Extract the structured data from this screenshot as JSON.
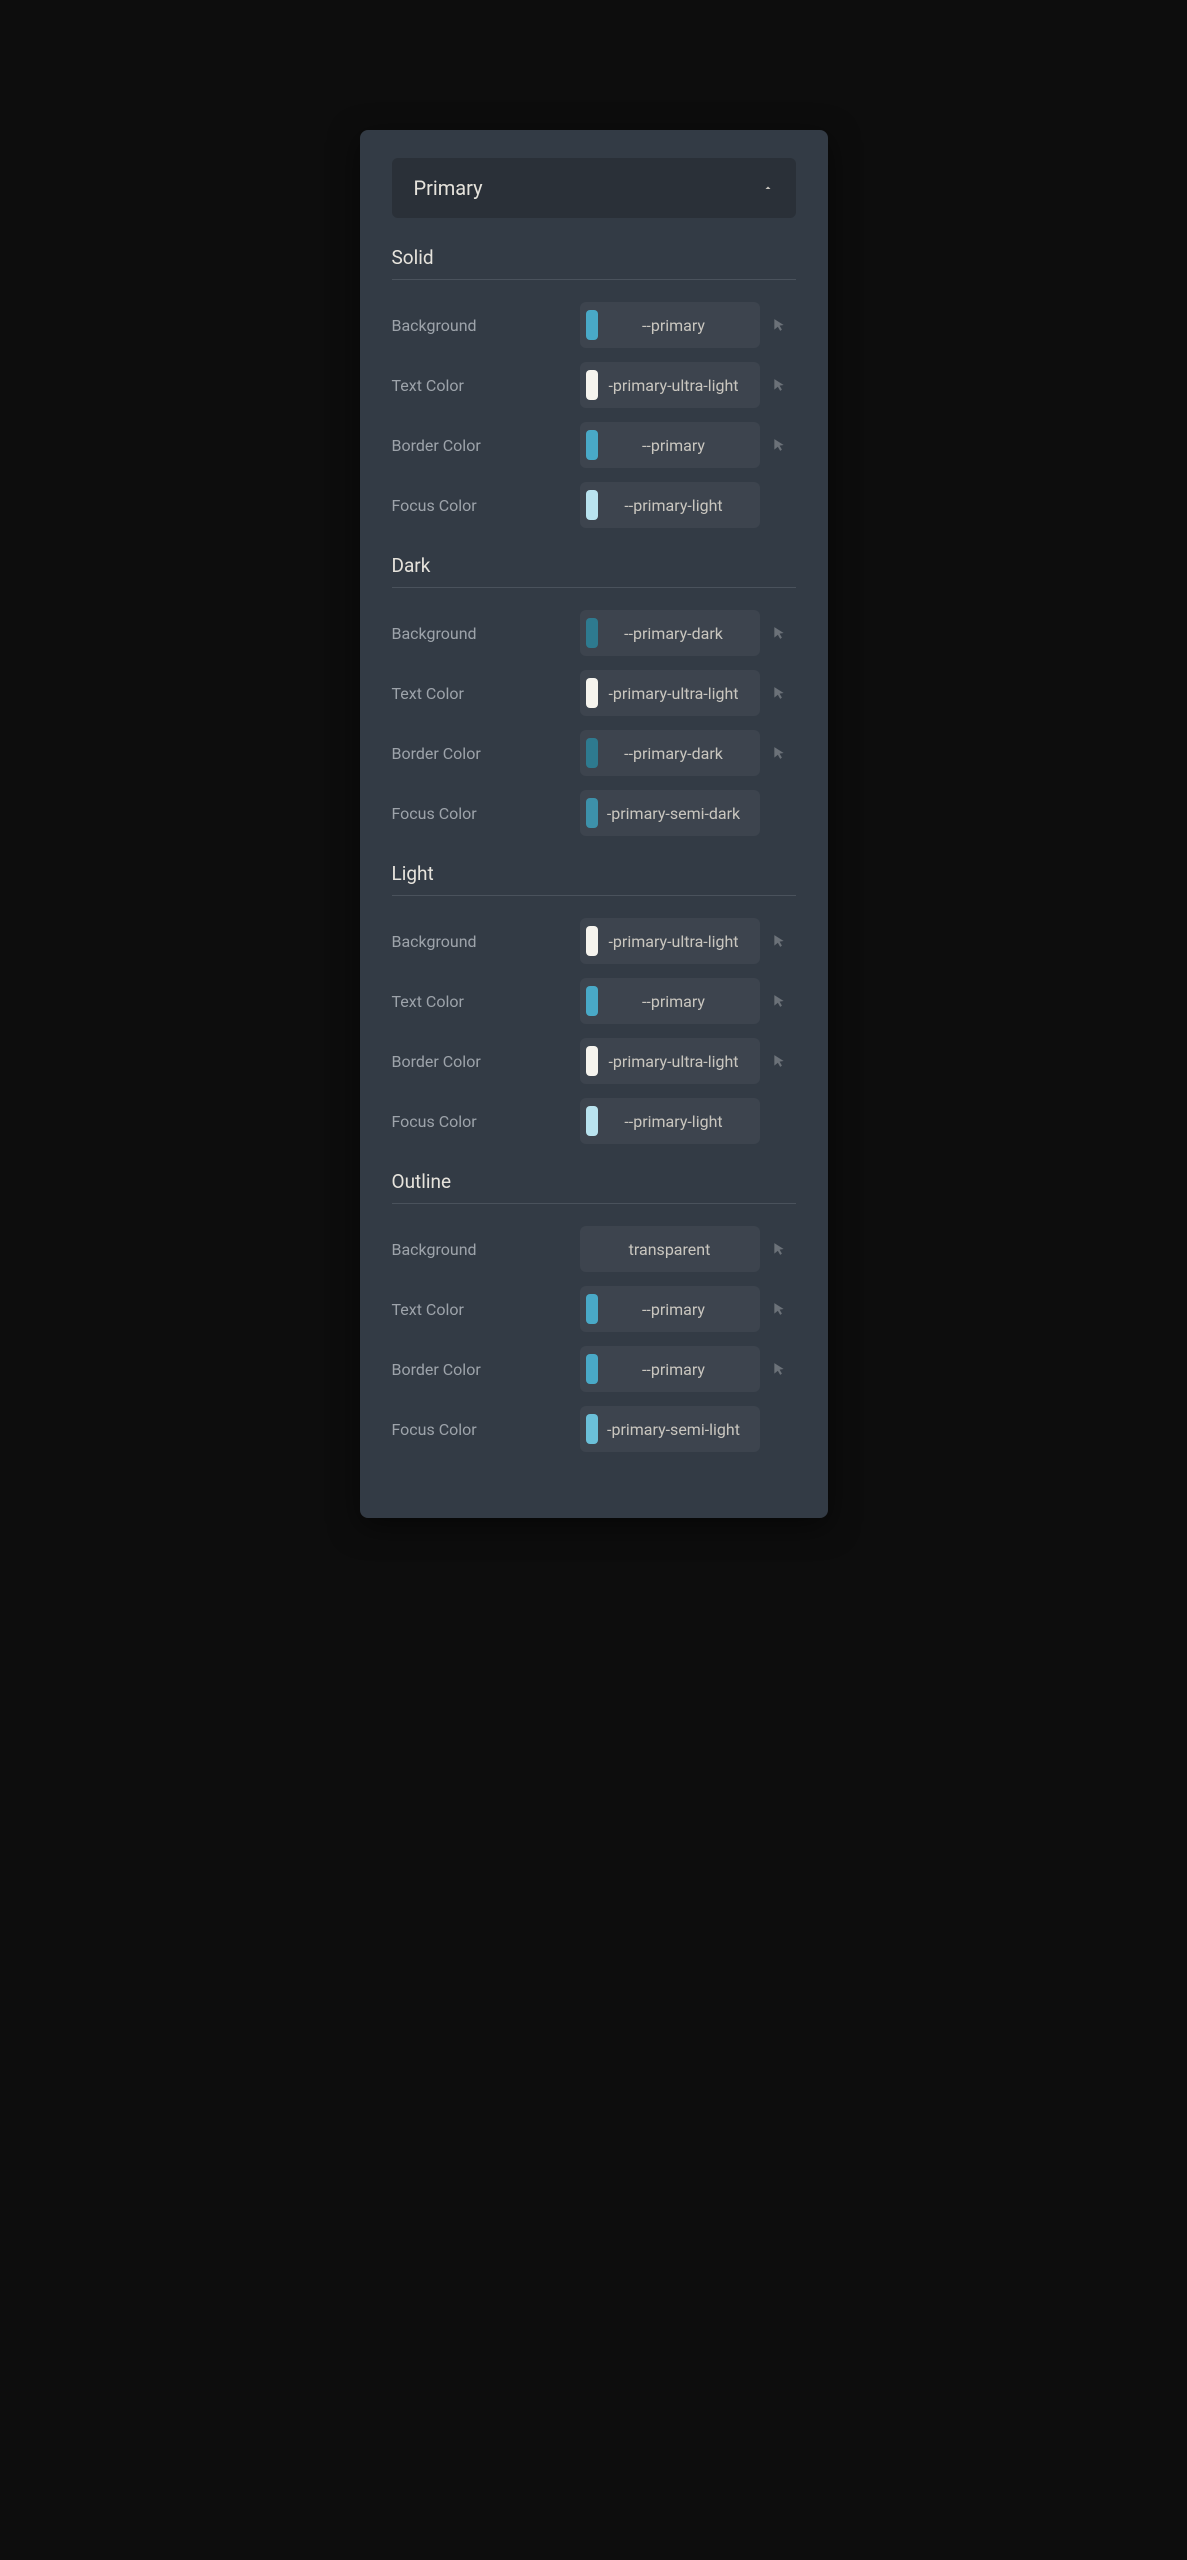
{
  "accordion": {
    "title": "Primary"
  },
  "swatches": {
    "primary": "#49a9c7",
    "primary_dark": "#2e7a8f",
    "primary_semi_dark": "#3d91aa",
    "primary_light": "#b9e3ef",
    "primary_semi_light": "#6bc0d9",
    "primary_ultra_light": "#f6f4ee"
  },
  "sections": [
    {
      "title": "Solid",
      "rows": [
        {
          "label": "Background",
          "value": "--primary",
          "swatch": "primary",
          "pickable": true
        },
        {
          "label": "Text Color",
          "value": "-primary-ultra-light",
          "swatch": "primary_ultra_light",
          "pickable": true
        },
        {
          "label": "Border Color",
          "value": "--primary",
          "swatch": "primary",
          "pickable": true
        },
        {
          "label": "Focus Color",
          "value": "--primary-light",
          "swatch": "primary_light",
          "pickable": false
        }
      ]
    },
    {
      "title": "Dark",
      "rows": [
        {
          "label": "Background",
          "value": "--primary-dark",
          "swatch": "primary_dark",
          "pickable": true
        },
        {
          "label": "Text Color",
          "value": "-primary-ultra-light",
          "swatch": "primary_ultra_light",
          "pickable": true
        },
        {
          "label": "Border Color",
          "value": "--primary-dark",
          "swatch": "primary_dark",
          "pickable": true
        },
        {
          "label": "Focus Color",
          "value": "-primary-semi-dark",
          "swatch": "primary_semi_dark",
          "pickable": false
        }
      ]
    },
    {
      "title": "Light",
      "rows": [
        {
          "label": "Background",
          "value": "-primary-ultra-light",
          "swatch": "primary_ultra_light",
          "pickable": true
        },
        {
          "label": "Text Color",
          "value": "--primary",
          "swatch": "primary",
          "pickable": true
        },
        {
          "label": "Border Color",
          "value": "-primary-ultra-light",
          "swatch": "primary_ultra_light",
          "pickable": true
        },
        {
          "label": "Focus Color",
          "value": "--primary-light",
          "swatch": "primary_light",
          "pickable": false
        }
      ]
    },
    {
      "title": "Outline",
      "rows": [
        {
          "label": "Background",
          "value": "transparent",
          "swatch": null,
          "pickable": true
        },
        {
          "label": "Text Color",
          "value": "--primary",
          "swatch": "primary",
          "pickable": true
        },
        {
          "label": "Border Color",
          "value": "--primary",
          "swatch": "primary",
          "pickable": true
        },
        {
          "label": "Focus Color",
          "value": "-primary-semi-light",
          "swatch": "primary_semi_light",
          "pickable": false
        }
      ]
    }
  ]
}
